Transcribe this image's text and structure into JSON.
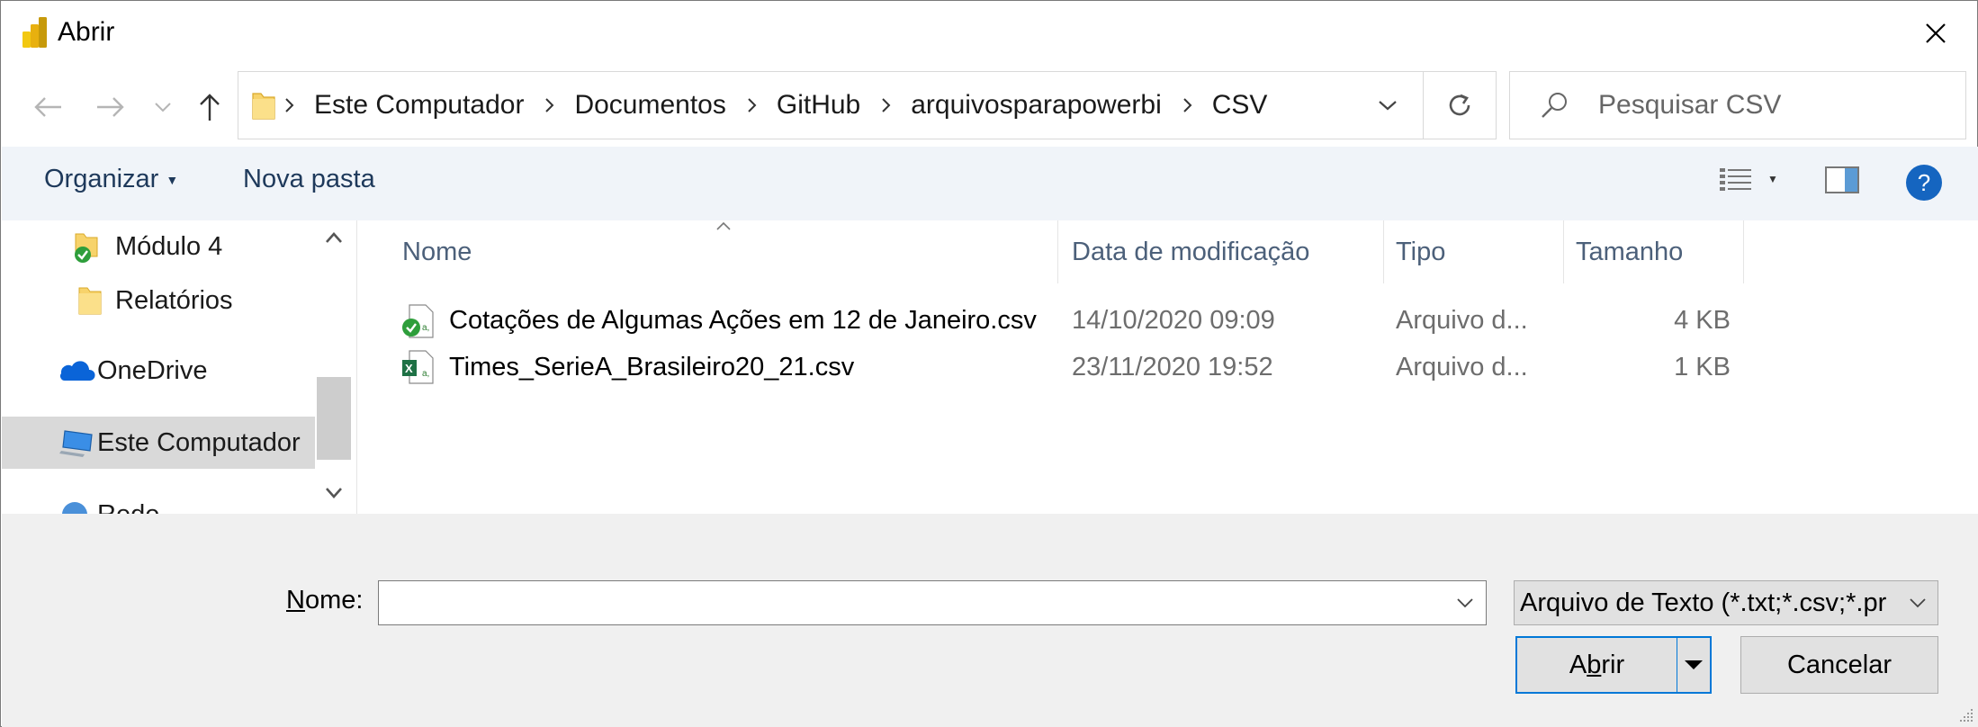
{
  "window": {
    "title": "Abrir",
    "icon": "power-bi-icon",
    "close_icon": "close-icon"
  },
  "navigation": {
    "back_icon": "arrow-left-icon",
    "forward_icon": "arrow-right-icon",
    "recent_icon": "chevron-down-icon",
    "up_icon": "arrow-up-icon",
    "breadcrumbs": [
      "Este Computador",
      "Documentos",
      "GitHub",
      "arquivosparapowerbi",
      "CSV"
    ],
    "refresh_icon": "refresh-icon"
  },
  "search": {
    "placeholder": "Pesquisar CSV",
    "icon": "search-icon"
  },
  "toolbar": {
    "organize_label": "Organizar",
    "new_folder_label": "Nova pasta",
    "help_label": "?"
  },
  "sidebar": {
    "items": [
      {
        "label": "Módulo 4",
        "icon": "synced-folder-icon"
      },
      {
        "label": "Relatórios",
        "icon": "folder-icon"
      },
      {
        "label": "OneDrive",
        "icon": "onedrive-cloud-icon"
      },
      {
        "label": "Este Computador",
        "icon": "computer-icon",
        "selected": true
      },
      {
        "label": "Rede",
        "icon": "network-icon"
      }
    ]
  },
  "filelist": {
    "columns": {
      "name": "Nome",
      "modified": "Data de modificação",
      "type": "Tipo",
      "size": "Tamanho"
    },
    "rows": [
      {
        "name": "Cotações de Algumas Ações em 12 de Janeiro.csv",
        "modified": "14/10/2020 09:09",
        "type": "Arquivo d...",
        "size": "4 KB",
        "icon": "csv-synced-file-icon"
      },
      {
        "name": "Times_SerieA_Brasileiro20_21.csv",
        "modified": "23/11/2020 19:52",
        "type": "Arquivo d...",
        "size": "1 KB",
        "icon": "csv-excel-file-icon"
      }
    ]
  },
  "footer": {
    "name_label_underlined": "N",
    "name_label_rest": "ome:",
    "name_value": "",
    "filter_value": "Arquivo de Texto (*.txt;*.csv;*.pr",
    "open_label_a": "A",
    "open_label_b": "b",
    "open_label_c": "rir",
    "cancel_label": "Cancelar"
  },
  "colors": {
    "accent": "#0078d7",
    "command_bar": "#f0f4f9",
    "footer_bg": "#f0f0f0",
    "header_text": "#4c607a"
  }
}
